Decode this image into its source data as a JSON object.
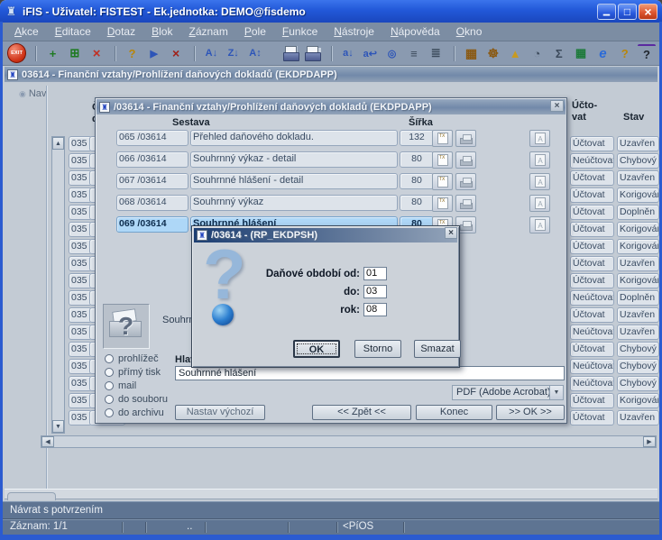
{
  "window": {
    "title": "iFIS - Uživatel: FISTEST - Ek.jednotka: DEMO@fisdemo"
  },
  "menu": {
    "items": [
      {
        "label": "Akce",
        "name": "menu-akce"
      },
      {
        "label": "Editace",
        "name": "menu-editace"
      },
      {
        "label": "Dotaz",
        "name": "menu-dotaz"
      },
      {
        "label": "Blok",
        "name": "menu-blok"
      },
      {
        "label": "Záznam",
        "name": "menu-zaznam"
      },
      {
        "label": "Pole",
        "name": "menu-pole"
      },
      {
        "label": "Funkce",
        "name": "menu-funkce"
      },
      {
        "label": "Nástroje",
        "name": "menu-nastroje"
      },
      {
        "label": "Nápověda",
        "name": "menu-napoveda"
      },
      {
        "label": "Okno",
        "name": "menu-okno"
      }
    ]
  },
  "toolbar": {
    "icons": [
      {
        "name": "exit-icon",
        "glyph": "EXIT",
        "cls": "ic-exit"
      },
      {
        "name": "insert-record-icon",
        "glyph": "+",
        "cls": "ic-green grp"
      },
      {
        "name": "duplicate-record-icon",
        "glyph": "⊞",
        "cls": "ic-green"
      },
      {
        "name": "delete-record-icon",
        "glyph": "×",
        "cls": "ic-red"
      },
      {
        "name": "enter-query-icon",
        "glyph": "?",
        "cls": "ic-gold grp"
      },
      {
        "name": "execute-query-icon",
        "glyph": "▶",
        "cls": "ic-blue"
      },
      {
        "name": "cancel-query-icon",
        "glyph": "×",
        "cls": "ic-darkred"
      },
      {
        "name": "sort-asc-icon",
        "glyph": "A↓",
        "cls": "ic-blue grp"
      },
      {
        "name": "sort-desc-icon",
        "glyph": "Z↓",
        "cls": "ic-blue"
      },
      {
        "name": "sort-custom-icon",
        "glyph": "A↕",
        "cls": "ic-blue"
      },
      {
        "name": "print-icon",
        "glyph": "",
        "cls": "ic-printer grp"
      },
      {
        "name": "print-setup-icon",
        "glyph": "",
        "cls": "ic-printer2"
      },
      {
        "name": "field-down-icon",
        "glyph": "a↓",
        "cls": "ic-blue grp"
      },
      {
        "name": "field-return-icon",
        "glyph": "a↩",
        "cls": "ic-blue"
      },
      {
        "name": "zoom-record-icon",
        "glyph": "◎",
        "cls": "ic-blue"
      },
      {
        "name": "list-values-icon",
        "glyph": "≡",
        "cls": "ic-dark"
      },
      {
        "name": "tree-view-icon",
        "glyph": "≣",
        "cls": "ic-dark"
      },
      {
        "name": "report-icon",
        "glyph": "▦",
        "cls": "ic-brown grp"
      },
      {
        "name": "navigator-wheel-icon",
        "glyph": "☸",
        "cls": "ic-brown"
      },
      {
        "name": "graph-icon",
        "glyph": "▲",
        "cls": "ic-gold2"
      },
      {
        "name": "gauge-icon",
        "glyph": "◔",
        "cls": "ic-dark"
      },
      {
        "name": "sum-icon",
        "glyph": "Σ",
        "cls": "ic-dark"
      },
      {
        "name": "excel-export-icon",
        "glyph": "▦",
        "cls": "ic-green2"
      },
      {
        "name": "browser-icon",
        "glyph": "e",
        "cls": "ic-ie"
      },
      {
        "name": "currency-help-icon",
        "glyph": "?",
        "cls": "ic-gold"
      },
      {
        "name": "help-icon",
        "glyph": "?",
        "cls": "ic-help"
      }
    ]
  },
  "mdi": {
    "title": "03614 - Finanční vztahy/Prohlížení daňových dokladů (EKDPDAPP)",
    "nav": "Nav"
  },
  "form": {
    "col_doc_header1": "Č",
    "col_doc_header2": "d",
    "col_account_header1": "Účto-",
    "col_account_header2": "vat",
    "col_status_header": "Stav",
    "doc_rows": [
      "035",
      "035",
      "035",
      "035",
      "035",
      "035",
      "035",
      "035",
      "035",
      "035",
      "035",
      "035",
      "035",
      "035",
      "035",
      "035",
      "035"
    ],
    "rows": [
      {
        "uctovat": "Účtovat",
        "stav": "Uzavřen"
      },
      {
        "uctovat": "Neúčtovat",
        "stav": "Chybový"
      },
      {
        "uctovat": "Účtovat",
        "stav": "Uzavřen"
      },
      {
        "uctovat": "Účtovat",
        "stav": "Korigován"
      },
      {
        "uctovat": "Účtovat",
        "stav": "Doplněn"
      },
      {
        "uctovat": "Účtovat",
        "stav": "Korigován"
      },
      {
        "uctovat": "Účtovat",
        "stav": "Korigován"
      },
      {
        "uctovat": "Účtovat",
        "stav": "Uzavřen"
      },
      {
        "uctovat": "Účtovat",
        "stav": "Korigován"
      },
      {
        "uctovat": "Neúčtovat",
        "stav": "Doplněn"
      },
      {
        "uctovat": "Účtovat",
        "stav": "Uzavřen"
      },
      {
        "uctovat": "Neúčtovat",
        "stav": "Uzavřen"
      },
      {
        "uctovat": "Účtovat",
        "stav": "Chybový"
      },
      {
        "uctovat": "Neúčtovat",
        "stav": "Chybový"
      },
      {
        "uctovat": "Neúčtovat",
        "stav": "Chybový"
      },
      {
        "uctovat": "Účtovat",
        "stav": "Korigován"
      },
      {
        "uctovat": "Účtovat",
        "stav": "Uzavřen"
      }
    ]
  },
  "report_dialog": {
    "title": "/03614 - Finanční vztahy/Prohlížení daňových dokladů (EKDPDAPP)",
    "col_sestava": "Sestava",
    "col_sirka": "Šířka",
    "rows": [
      {
        "num": "065 /03614",
        "name": "Přehled daňového dokladu.",
        "width": "132"
      },
      {
        "num": "066 /03614",
        "name": "Souhrnný výkaz - detail",
        "width": "80"
      },
      {
        "num": "067 /03614",
        "name": "Souhrnné hlášení - detail",
        "width": "80"
      },
      {
        "num": "068 /03614",
        "name": "Souhrnný výkaz",
        "width": "80"
      },
      {
        "num": "069 /03614",
        "name": "Souhrnné hlášení",
        "width": "80"
      }
    ],
    "output_label": "Souhrn",
    "radio_options": [
      "prohlížeč",
      "přímý tisk",
      "mail",
      "do souboru",
      "do archivu"
    ],
    "header_label": "Hlav",
    "report_title_value": "Souhrnné hlášení",
    "format_value": "PDF (Adobe Acrobat)",
    "btn_default": "Nastav výchozí",
    "btn_back": "<< Zpět <<",
    "btn_end": "Konec",
    "btn_ok": ">> OK >>"
  },
  "param_dialog": {
    "title": "/03614 - (RP_EKDPSH)",
    "field1_label": "Daňové období od:",
    "field1_value": "01",
    "field2_label": "do:",
    "field2_value": "03",
    "field3_label": "rok:",
    "field3_value": "08",
    "btn_ok": "OK",
    "btn_cancel": "Storno",
    "btn_delete": "Smazat"
  },
  "statusbar": {
    "message": "Návrat s potvrzením",
    "record": "Záznam: 1/1",
    "dots": "..",
    "mode": "<PíOS"
  }
}
